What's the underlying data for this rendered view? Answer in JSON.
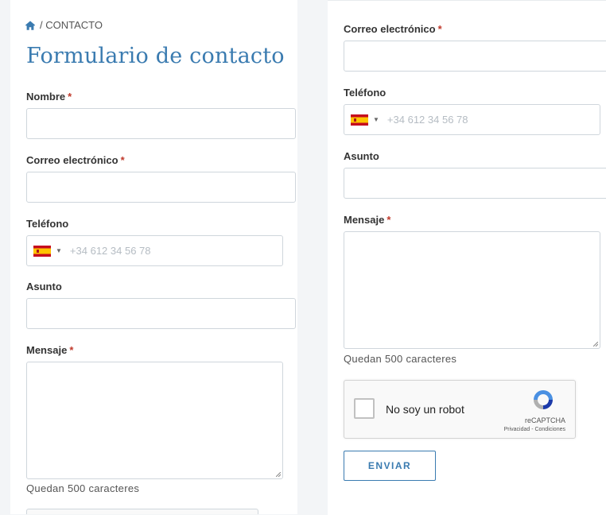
{
  "breadcrumb": {
    "current": "/ CONTACTO"
  },
  "page_title": "Formulario de contacto",
  "form": {
    "nombre_label": "Nombre",
    "email_label": "Correo electrónico",
    "phone_label": "Teléfono",
    "phone_placeholder": "+34 612 34 56 78",
    "subject_label": "Asunto",
    "message_label": "Mensaje",
    "required_marker": "*",
    "counter_text": "Quedan 500 caracteres",
    "submit_label": "ENVIAR"
  },
  "recaptcha": {
    "label": "No soy un robot",
    "brand": "reCAPTCHA",
    "terms": "Privacidad - Condiciones"
  },
  "colors": {
    "accent": "#3a7bb0",
    "required": "#c0392b",
    "border": "#cfd6dc"
  }
}
